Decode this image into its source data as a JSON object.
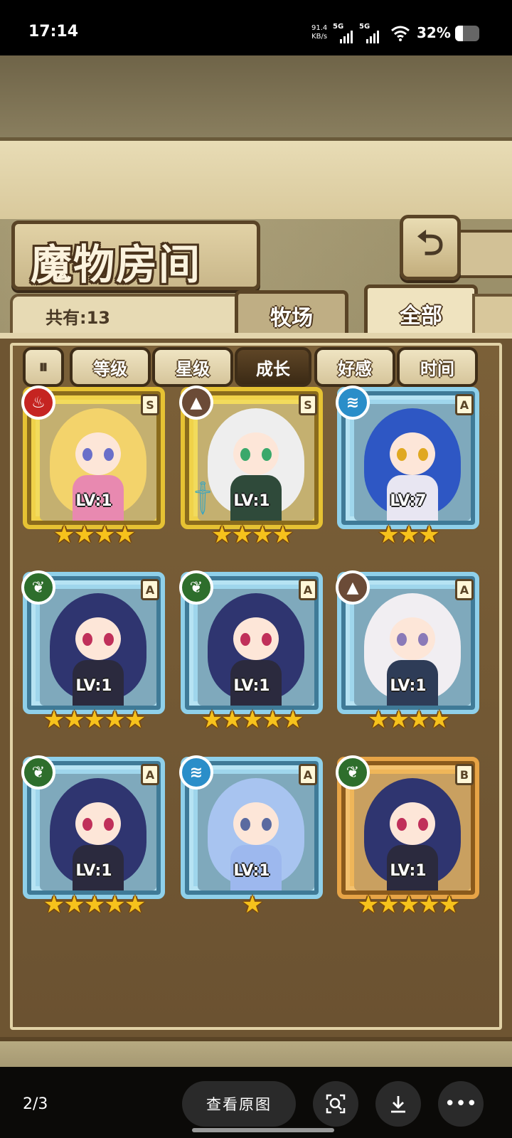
{
  "status_bar": {
    "time": "17:14",
    "net_speed_value": "91.4",
    "net_speed_unit": "KB/s",
    "sim1": "5G",
    "sim2": "5G",
    "battery": "32%",
    "battery_level": 0.32
  },
  "header": {
    "title": "魔物房间",
    "back_icon": "back-arrow-icon"
  },
  "count_label": "共有:13",
  "tabs": [
    {
      "label": "牧场",
      "active": false
    },
    {
      "label": "全部",
      "active": true
    }
  ],
  "filters": [
    {
      "label": "等级",
      "selected": false
    },
    {
      "label": "星级",
      "selected": false
    },
    {
      "label": "成长",
      "selected": true
    },
    {
      "label": "好感",
      "selected": false
    },
    {
      "label": "时间",
      "selected": false
    }
  ],
  "filter_toggle_icon": "sort-toggle-icon",
  "monsters": [
    {
      "element": "fire",
      "rank": "S",
      "level": "LV:1",
      "stars": 4,
      "frame": "gold",
      "hair": "#f3d36b",
      "outfit": "#e889b0",
      "eyes": "#6a6fc9"
    },
    {
      "element": "earth",
      "rank": "S",
      "level": "LV:1",
      "stars": 4,
      "frame": "gold",
      "hair": "#eeeeee",
      "outfit": "#2f4a3a",
      "eyes": "#3aa86b",
      "sword": true
    },
    {
      "element": "water",
      "rank": "A",
      "level": "LV:7",
      "stars": 3,
      "frame": "blue",
      "hair": "#2e57c4",
      "outfit": "#e8e6f2",
      "eyes": "#e0a820"
    },
    {
      "element": "wood",
      "rank": "A",
      "level": "LV:1",
      "stars": 5,
      "frame": "blue",
      "hair": "#2f3570",
      "outfit": "#2b2a3e",
      "eyes": "#c0305a"
    },
    {
      "element": "wood",
      "rank": "A",
      "level": "LV:1",
      "stars": 5,
      "frame": "blue",
      "hair": "#2f3570",
      "outfit": "#2b2a3e",
      "eyes": "#c0305a"
    },
    {
      "element": "earth",
      "rank": "A",
      "level": "LV:1",
      "stars": 4,
      "frame": "blue",
      "hair": "#f1eef2",
      "outfit": "#2e3c57",
      "eyes": "#8a7ab8"
    },
    {
      "element": "wood",
      "rank": "A",
      "level": "LV:1",
      "stars": 5,
      "frame": "blue",
      "hair": "#2f3570",
      "outfit": "#2b2a3e",
      "eyes": "#c0305a"
    },
    {
      "element": "water",
      "rank": "A",
      "level": "LV:1",
      "stars": 1,
      "frame": "blue",
      "hair": "#a8c4f0",
      "outfit": "#9db8ee",
      "eyes": "#5a6aa0"
    },
    {
      "element": "wood",
      "rank": "B",
      "level": "LV:1",
      "stars": 5,
      "frame": "orange",
      "hair": "#2f3570",
      "outfit": "#2b2a3e",
      "eyes": "#c0305a"
    }
  ],
  "element_glyphs": {
    "fire": "♨",
    "earth": "▲",
    "water": "≋",
    "wood": "❦"
  },
  "nav": {
    "page_indicator": "2/3",
    "view_original": "查看原图",
    "search_icon": "image-search-icon",
    "download_icon": "download-icon",
    "more_icon": "more-icon"
  }
}
